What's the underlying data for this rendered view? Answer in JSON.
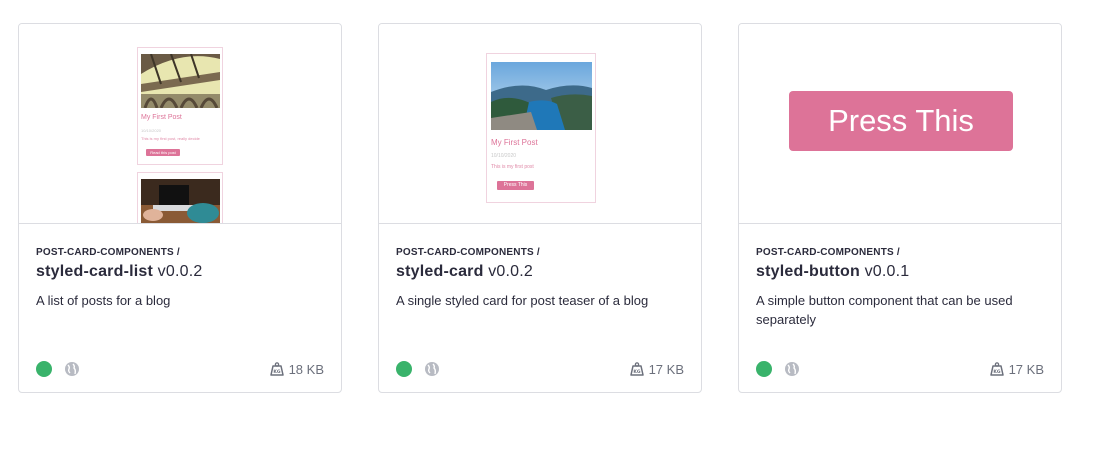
{
  "cards": [
    {
      "scope": "POST-CARD-COMPONENTS /",
      "name": "styled-card-list",
      "version": "v0.0.2",
      "description": "A list of posts for a blog",
      "size": "18 KB",
      "preview": {
        "post_title": "My First Post",
        "post_date": "10/10/2020",
        "post_text": "This is my first post, really decide",
        "button_label": "Read this post"
      }
    },
    {
      "scope": "POST-CARD-COMPONENTS /",
      "name": "styled-card",
      "version": "v0.0.2",
      "description": "A single styled card for post teaser of a blog",
      "size": "17 KB",
      "preview": {
        "post_title": "My First Post",
        "post_date": "10/10/2020",
        "post_text": "This is my first post",
        "button_label": "Press This"
      }
    },
    {
      "scope": "POST-CARD-COMPONENTS /",
      "name": "styled-button",
      "version": "v0.0.1",
      "description": "A simple button component that can be used separately",
      "size": "17 KB",
      "preview": {
        "button_label": "Press This"
      }
    }
  ],
  "colors": {
    "accent": "#dd7398",
    "status_green": "#39b36b",
    "border": "#dcdde2"
  },
  "icons": [
    "status-dot-icon",
    "globe-icon",
    "package-weight-icon"
  ]
}
